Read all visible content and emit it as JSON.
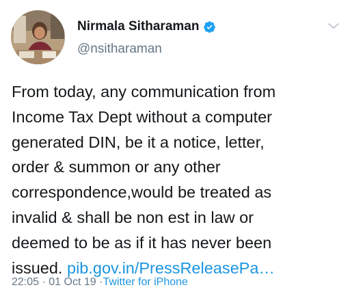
{
  "tweet": {
    "author_name": "Nirmala Sitharaman",
    "author_handle": "@nsitharaman",
    "verified": true,
    "text": "From today, any communication from\nIncome Tax Dept without a computer\ngenerated DIN, be it a notice, letter,\norder & summon or any other\ncorrespondence,would be treated as\ninvalid & shall be non est in law or\ndeemed to be as if it has never been\nissued.",
    "link_text": "pib.gov.in/PressReleasePa…",
    "time": "22:05",
    "date": "01 Oct 19",
    "separator": "·",
    "source": "Twitter for iPhone"
  },
  "icons": {
    "verified": "verified-badge-icon",
    "menu": "chevron-down-icon"
  },
  "colors": {
    "link": "#1b95e0",
    "verified": "#1da1f2",
    "secondary_text": "#657786",
    "primary_text": "#14171a"
  }
}
